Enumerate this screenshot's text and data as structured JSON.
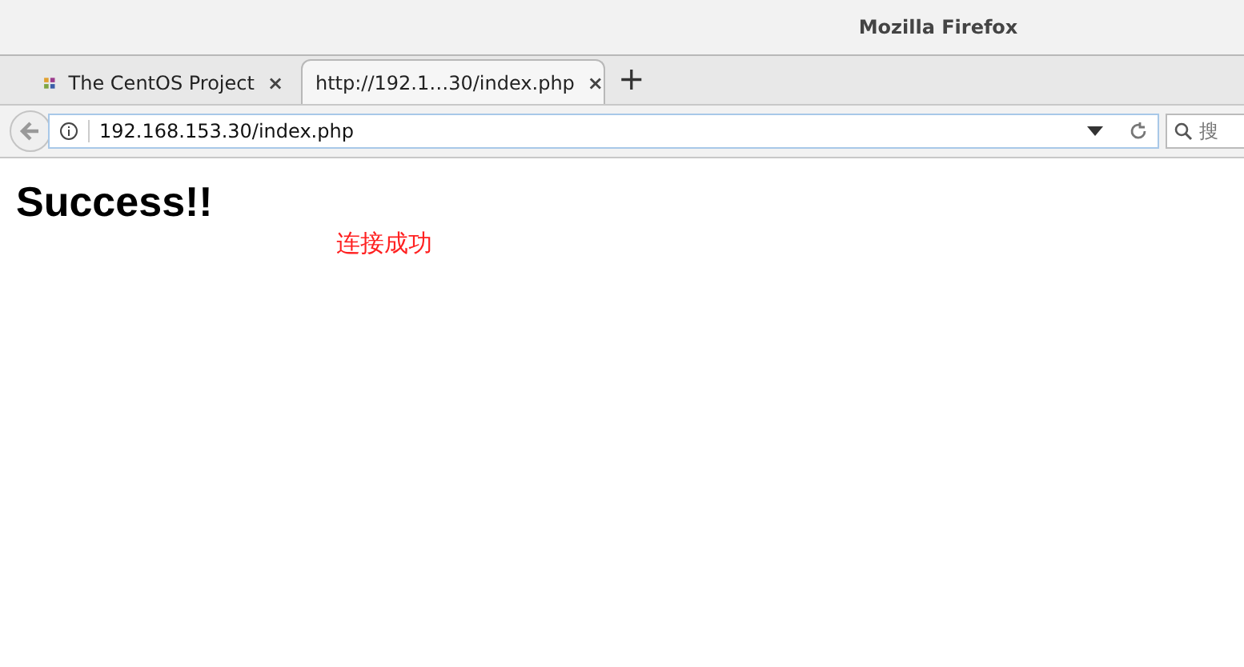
{
  "window": {
    "title": "Mozilla Firefox"
  },
  "tabs": [
    {
      "label": "The CentOS Project",
      "selected": false,
      "close": "×"
    },
    {
      "label": "http://192.1…30/index.php",
      "selected": true,
      "close": "×"
    }
  ],
  "new_tab": "+",
  "address_bar": {
    "value": "192.168.153.30/index.php"
  },
  "search": {
    "placeholder": "搜"
  },
  "page": {
    "heading": "Success!!",
    "message": "连接成功"
  }
}
